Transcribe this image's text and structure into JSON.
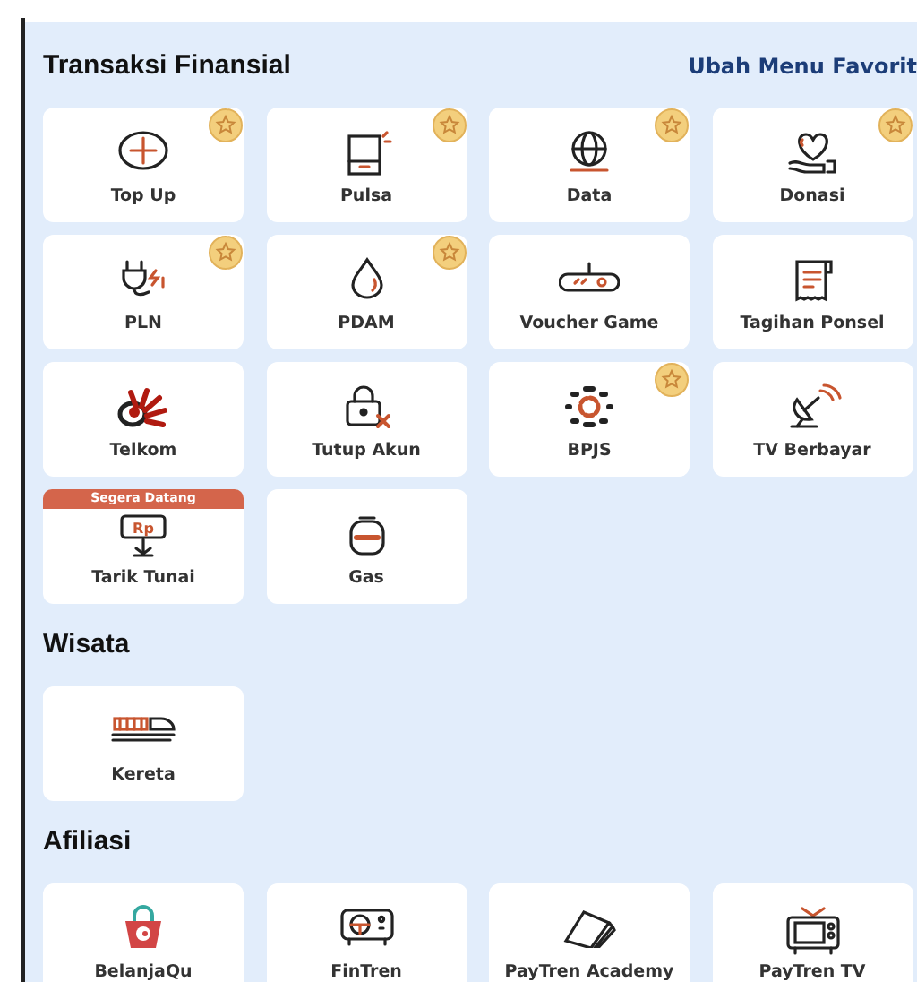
{
  "sections": [
    {
      "title": "Transaksi Finansial",
      "link": "Ubah Menu Favorit",
      "items": [
        {
          "label": "Top Up",
          "favorite": true
        },
        {
          "label": "Pulsa",
          "favorite": true
        },
        {
          "label": "Data",
          "favorite": true
        },
        {
          "label": "Donasi",
          "favorite": true
        },
        {
          "label": "PLN",
          "favorite": true
        },
        {
          "label": "PDAM",
          "favorite": true
        },
        {
          "label": "Voucher Game",
          "favorite": false
        },
        {
          "label": "Tagihan Ponsel",
          "favorite": false
        },
        {
          "label": "Telkom",
          "favorite": false
        },
        {
          "label": "Tutup Akun",
          "favorite": false
        },
        {
          "label": "BPJS",
          "favorite": true
        },
        {
          "label": "TV Berbayar",
          "favorite": false
        },
        {
          "label": "Tarik Tunai",
          "favorite": false,
          "badge": "Segera Datang",
          "icon_text": "Rp"
        },
        {
          "label": "Gas",
          "favorite": false
        }
      ]
    },
    {
      "title": "Wisata",
      "items": [
        {
          "label": "Kereta",
          "favorite": false
        }
      ]
    },
    {
      "title": "Afiliasi",
      "items": [
        {
          "label": "BelanjaQu",
          "favorite": false
        },
        {
          "label": "FinTren",
          "favorite": false
        },
        {
          "label": "PayTren Academy",
          "favorite": false
        },
        {
          "label": "PayTren TV",
          "favorite": false
        }
      ]
    }
  ]
}
